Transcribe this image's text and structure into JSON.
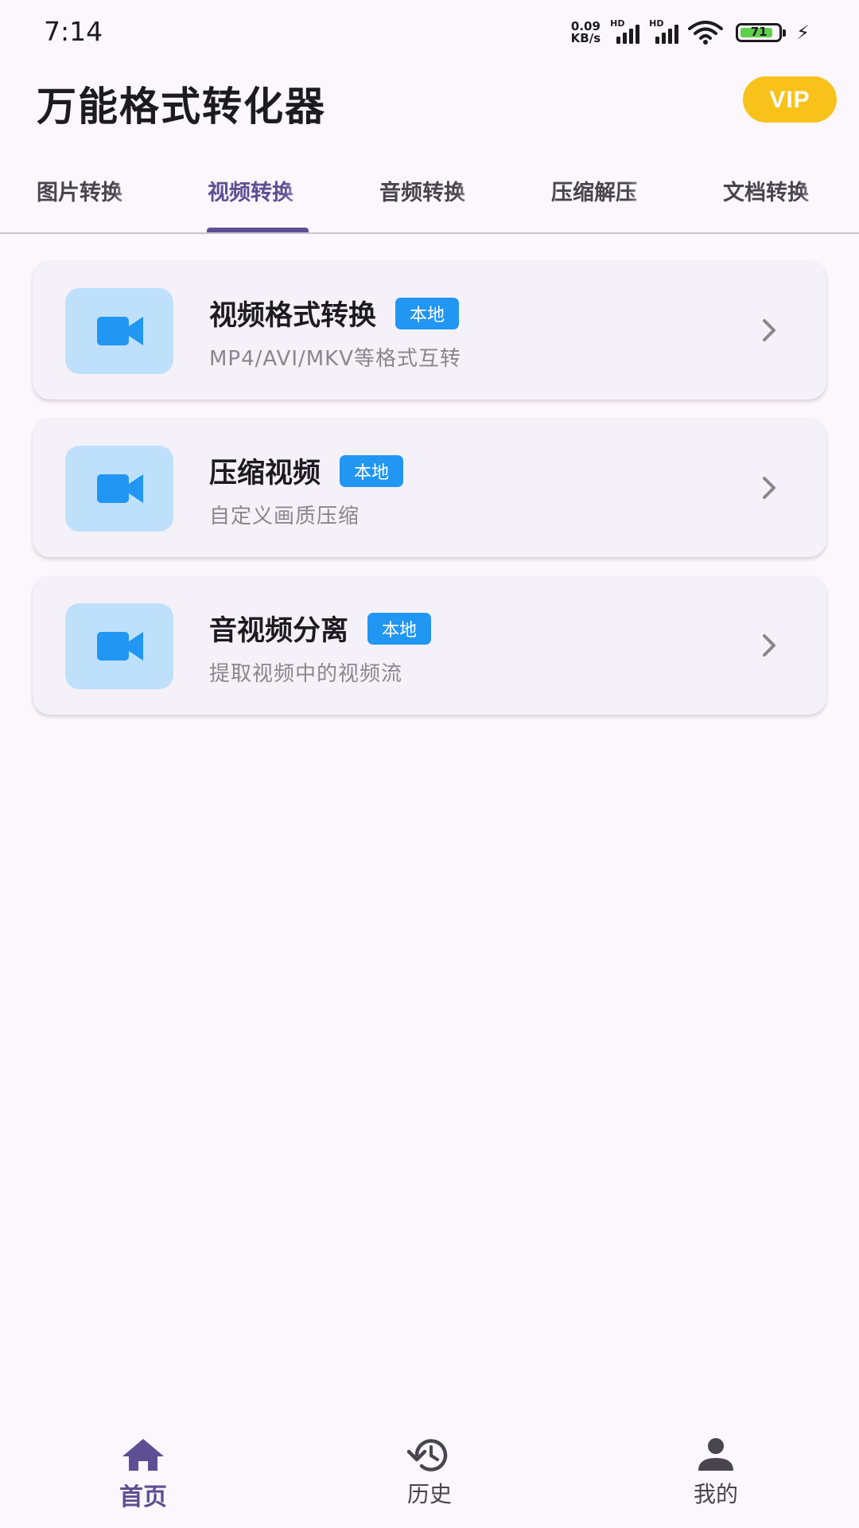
{
  "status_bar": {
    "time": "7:14",
    "net_speed_value": "0.09",
    "net_speed_unit": "KB/s",
    "signal_label": "HD",
    "battery": "71"
  },
  "app_bar": {
    "title": "万能格式转化器",
    "vip_label": "VIP"
  },
  "tabs": [
    {
      "label": "图片转换"
    },
    {
      "label": "视频转换",
      "active": true
    },
    {
      "label": "音频转换"
    },
    {
      "label": "压缩解压"
    },
    {
      "label": "文档转换"
    }
  ],
  "cards": [
    {
      "title": "视频格式转换",
      "badge": "本地",
      "desc": "MP4/AVI/MKV等格式互转",
      "icon": "video-camera-icon"
    },
    {
      "title": "压缩视频",
      "badge": "本地",
      "desc": "自定义画质压缩",
      "icon": "video-camera-icon"
    },
    {
      "title": "音视频分离",
      "badge": "本地",
      "desc": "提取视频中的视频流",
      "icon": "video-camera-icon"
    }
  ],
  "bottom_nav": [
    {
      "label": "首页",
      "icon": "home-icon",
      "active": true
    },
    {
      "label": "历史",
      "icon": "history-icon"
    },
    {
      "label": "我的",
      "icon": "person-icon"
    }
  ],
  "colors": {
    "accent": "#5d4f93",
    "vip": "#f8c21b",
    "badge": "#2196f3",
    "icon_box": "#bfe0fb",
    "background": "#fcf7fc"
  }
}
